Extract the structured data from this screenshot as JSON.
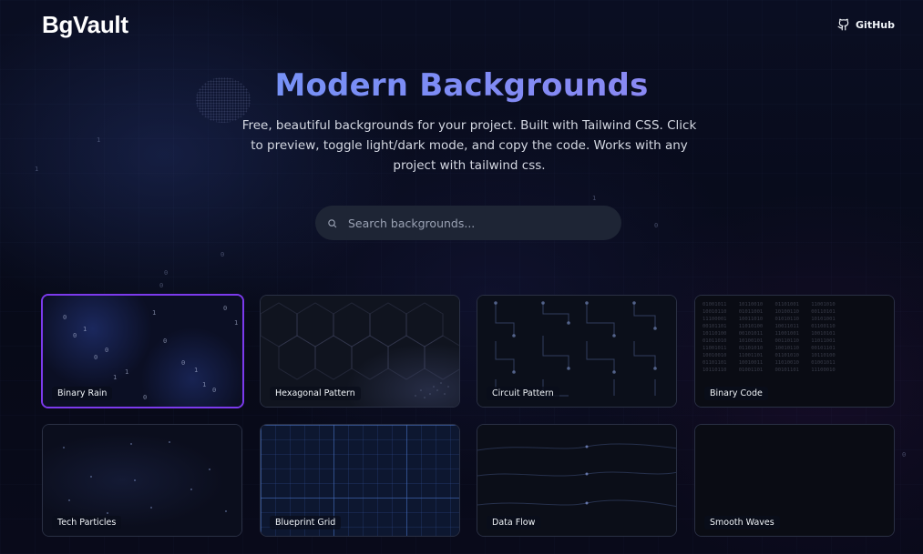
{
  "app": {
    "logo": "BgVault",
    "github_label": "GitHub"
  },
  "hero": {
    "title": "Modern Backgrounds",
    "subtitle": "Free, beautiful backgrounds for your project. Built with Tailwind CSS. Click to preview, toggle light/dark mode, and copy the code. Works with any project with tailwind css."
  },
  "search": {
    "placeholder": "Search backgrounds..."
  },
  "cards": [
    {
      "label": "Binary Rain",
      "selected": true
    },
    {
      "label": "Hexagonal Pattern",
      "selected": false
    },
    {
      "label": "Circuit Pattern",
      "selected": false
    },
    {
      "label": "Binary Code",
      "selected": false
    },
    {
      "label": "Tech Particles",
      "selected": false
    },
    {
      "label": "Blueprint Grid",
      "selected": false
    },
    {
      "label": "Data Flow",
      "selected": false
    },
    {
      "label": "Smooth Waves",
      "selected": false
    }
  ],
  "colors": {
    "selected_border": "#7c3aed",
    "title_gradient_start": "#6d9cf7",
    "title_gradient_end": "#9a85f0",
    "background": "#080b1a"
  }
}
